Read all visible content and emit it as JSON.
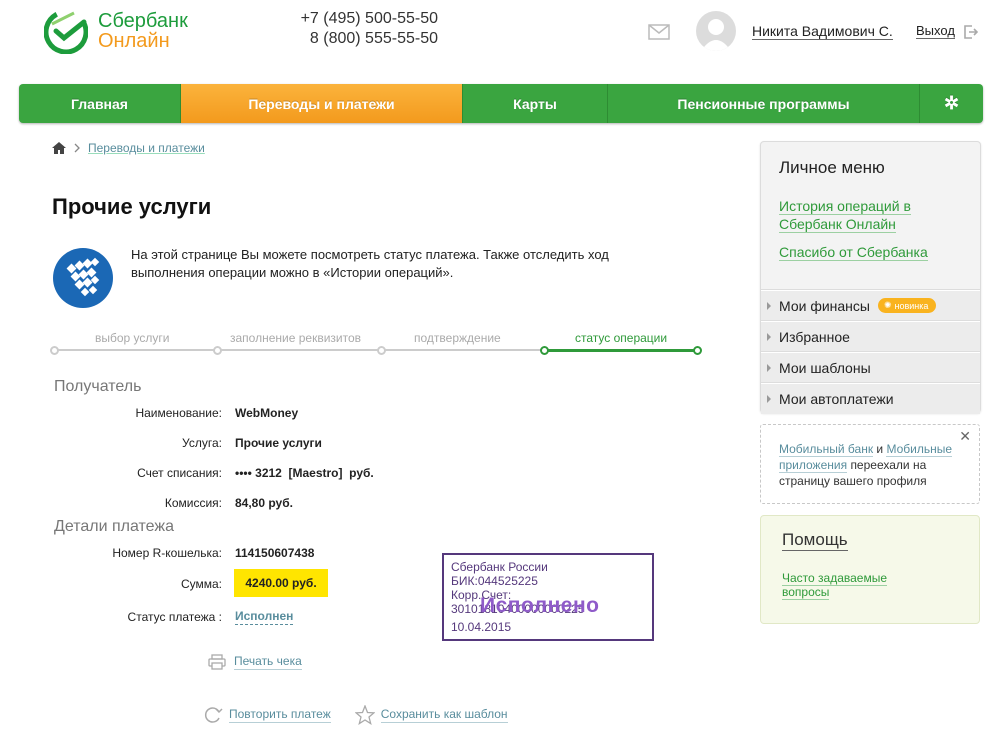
{
  "header": {
    "brand_line1": "Сбербанк",
    "brand_line2": "Онлайн",
    "phone1": "+7 (495) 500-55-50",
    "phone2": "8 (800) 555-55-50",
    "user_name": "Никита Вадимович С.",
    "logout": "Выход"
  },
  "nav": {
    "items": [
      {
        "label": "Главная"
      },
      {
        "label": "Переводы и платежи",
        "active": true
      },
      {
        "label": "Карты"
      },
      {
        "label": "Пенсионные программы"
      }
    ],
    "settings_icon": "gear-icon"
  },
  "breadcrumb": {
    "home_icon": "home-icon",
    "link": "Переводы и платежи"
  },
  "page": {
    "title": "Прочие услуги",
    "intro": "На этой странице Вы можете посмотреть статус платежа. Также отследить ход выполнения операции можно в «Истории операций»."
  },
  "steps": [
    {
      "label": "выбор услуги"
    },
    {
      "label": "заполнение реквизитов"
    },
    {
      "label": "подтверждение"
    },
    {
      "label": "статус операции",
      "current": true
    }
  ],
  "recipient": {
    "section_title": "Получатель",
    "name_label": "Наименование:",
    "name_value": "WebMoney",
    "service_label": "Услуга:",
    "service_value": "Прочие услуги",
    "account_label": "Счет списания:",
    "account_value": "•••• 3212  [Maestro]  руб.",
    "fee_label": "Комиссия:",
    "fee_value": "84,80 руб."
  },
  "payment": {
    "section_title": "Детали платежа",
    "wallet_label": "Номер R-кошелька:",
    "wallet_value": "114150607438",
    "amount_label": "Сумма:",
    "amount_value": "4240.00 руб.",
    "status_label": "Статус платежа :",
    "status_value": "Исполнен"
  },
  "stamp": {
    "bank": "Сбербанк России",
    "bik": "БИК:044525225",
    "corr": "Корр.Счет: 30101810400000000225",
    "status": "Исполнено",
    "date": "10.04.2015"
  },
  "actions": {
    "print": "Печать чека",
    "repeat": "Повторить платеж",
    "save_template": "Сохранить как шаблон"
  },
  "personal_menu": {
    "title": "Личное меню",
    "links": [
      "История операций в Сбербанк Онлайн",
      "Спасибо от Сбербанка"
    ],
    "items": [
      {
        "label": "Мои финансы",
        "badge": "новинка"
      },
      {
        "label": "Избранное"
      },
      {
        "label": "Мои шаблоны"
      },
      {
        "label": "Мои автоплатежи"
      }
    ]
  },
  "notice": {
    "link1": "Мобильный банк",
    "and": "и",
    "link2": "Мобильные приложения",
    "text": "переехали на страницу вашего профиля",
    "close": "✕"
  },
  "help": {
    "title": "Помощь",
    "link": "Часто задаваемые вопросы"
  },
  "colors": {
    "brand_green": "#3aa540",
    "brand_orange": "#f39a1d",
    "link": "#598d9d",
    "highlight": "#ffe500",
    "stamp": "#55387c"
  }
}
